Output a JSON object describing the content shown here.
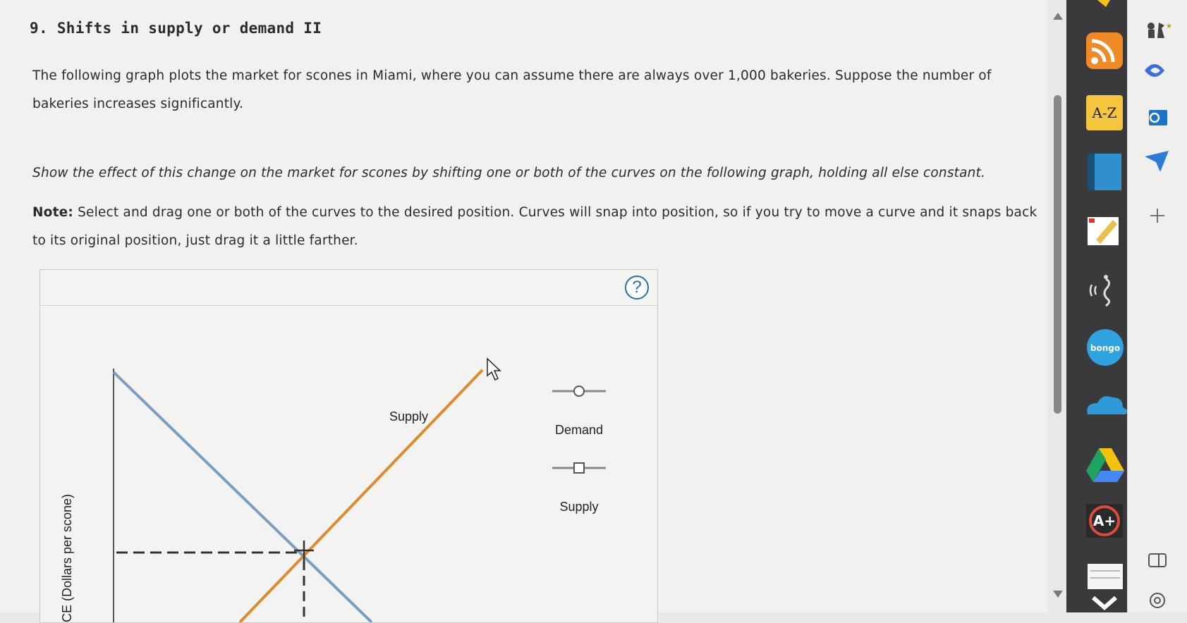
{
  "question": {
    "title": "9. Shifts in supply or demand II",
    "intro": "The following graph plots the market for scones in Miami, where you can assume there are always over 1,000 bakeries. Suppose the number of bakeries increases significantly.",
    "instruction": "Show the effect of this change on the market for scones by shifting one or both of the curves on the following graph, holding all else constant.",
    "note_label": "Note:",
    "note_text": " Select and drag one or both of the curves to the desired position. Curves will snap into position, so if you try to move a curve and it snaps back to its original position, just drag it a little farther."
  },
  "graph": {
    "help_label": "?",
    "y_axis_title": "CE (Dollars per scone)",
    "curve_label_supply": "Supply",
    "legend": [
      {
        "label": "Demand",
        "marker": "circle"
      },
      {
        "label": "Supply",
        "marker": "square"
      }
    ],
    "colors": {
      "demand": "#7a9dc4",
      "supply": "#e08a2e",
      "equilibrium": "#333333"
    }
  },
  "dock": {
    "items": [
      {
        "icon": "rss-icon"
      },
      {
        "icon": "a-z-icon",
        "label": "A-Z"
      },
      {
        "icon": "book-icon"
      },
      {
        "icon": "highlighter-icon"
      },
      {
        "icon": "read-aloud-icon"
      },
      {
        "icon": "bongo-icon",
        "label": "bongo"
      },
      {
        "icon": "cloud-icon"
      },
      {
        "icon": "google-drive-icon"
      },
      {
        "icon": "a-plus-icon",
        "label": "A+"
      },
      {
        "icon": "notes-icon"
      }
    ]
  },
  "sidebar": {
    "items": [
      {
        "icon": "chess-icon"
      },
      {
        "icon": "copilot-icon"
      },
      {
        "icon": "outlook-icon"
      },
      {
        "icon": "send-icon"
      },
      {
        "icon": "plus-icon"
      },
      {
        "icon": "split-view-icon"
      },
      {
        "icon": "settings-icon"
      }
    ]
  }
}
